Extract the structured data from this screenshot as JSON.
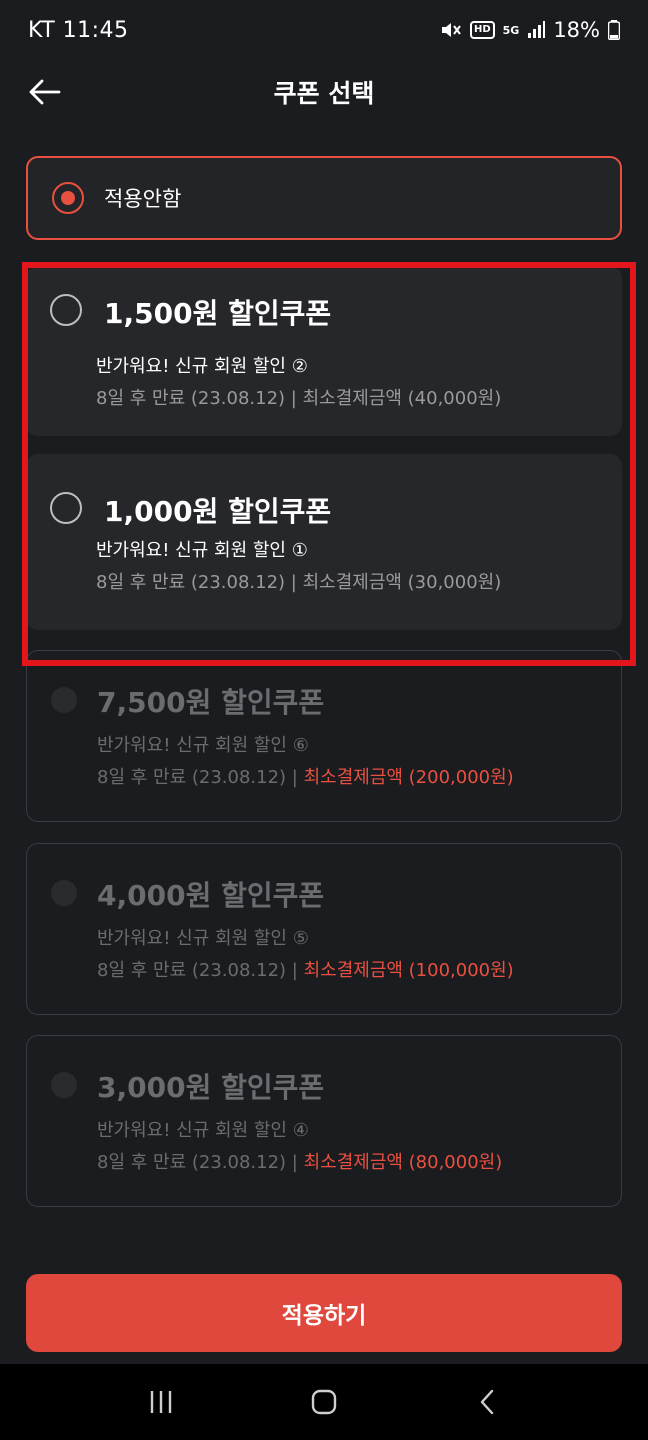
{
  "status_bar": {
    "carrier_time": "KT 11:45",
    "hd": "HD",
    "network": "5G",
    "battery": "18%"
  },
  "header": {
    "title": "쿠폰 선택"
  },
  "none_option": {
    "label": "적용안함",
    "selected": true
  },
  "coupons": [
    {
      "title": "1,500원 할인쿠폰",
      "subtitle": "반가워요! 신규 회원 할인 ②",
      "expiry": "8일 후 만료 (23.08.12) | ",
      "min_payment": "최소결제금액 (40,000원)",
      "enabled": true
    },
    {
      "title": "1,000원 할인쿠폰",
      "subtitle": "반가워요! 신규 회원 할인 ①",
      "expiry": "8일 후 만료 (23.08.12) | ",
      "min_payment": "최소결제금액 (30,000원)",
      "enabled": true
    },
    {
      "title": "7,500원 할인쿠폰",
      "subtitle": "반가워요! 신규 회원 할인 ⑥",
      "expiry": "8일 후 만료 (23.08.12) | ",
      "min_payment": "최소결제금액 (200,000원)",
      "enabled": false
    },
    {
      "title": "4,000원 할인쿠폰",
      "subtitle": "반가워요! 신규 회원 할인 ⑤",
      "expiry": "8일 후 만료 (23.08.12) | ",
      "min_payment": "최소결제금액 (100,000원)",
      "enabled": false
    },
    {
      "title": "3,000원 할인쿠폰",
      "subtitle": "반가워요! 신규 회원 할인 ④",
      "expiry": "8일 후 만료 (23.08.12) | ",
      "min_payment": "최소결제금액 (80,000원)",
      "enabled": false
    }
  ],
  "apply_button": {
    "label": "적용하기"
  },
  "colors": {
    "accent": "#e8503f",
    "background": "#1b1c20",
    "highlight": "#e3161e"
  },
  "icons": {
    "back": "arrow-left-icon",
    "mute": "mute-icon",
    "signal": "signal-icon",
    "battery": "battery-icon",
    "nav_recents": "recents-icon",
    "nav_home": "home-icon",
    "nav_back": "chevron-left-icon"
  }
}
